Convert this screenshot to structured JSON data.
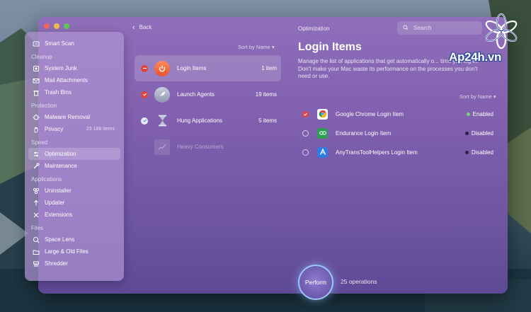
{
  "window": {
    "back_label": "Back",
    "panel_caption": "Optimization",
    "search_placeholder": "Search"
  },
  "sidebar": {
    "top_item": {
      "label": "Smart Scan",
      "icon": "smart-scan-icon"
    },
    "sections": [
      {
        "title": "Cleanup",
        "items": [
          {
            "label": "System Junk",
            "icon": "system-junk-icon"
          },
          {
            "label": "Mail Attachments",
            "icon": "mail-icon"
          },
          {
            "label": "Trash Bins",
            "icon": "trash-icon"
          }
        ]
      },
      {
        "title": "Protection",
        "items": [
          {
            "label": "Malware Removal",
            "icon": "malware-icon"
          },
          {
            "label": "Privacy",
            "icon": "privacy-hand-icon",
            "count": "23 188 items"
          }
        ]
      },
      {
        "title": "Speed",
        "items": [
          {
            "label": "Optimization",
            "icon": "optimization-icon",
            "active": true
          },
          {
            "label": "Maintenance",
            "icon": "maintenance-icon"
          }
        ]
      },
      {
        "title": "Applications",
        "items": [
          {
            "label": "Uninstaller",
            "icon": "uninstaller-icon"
          },
          {
            "label": "Updater",
            "icon": "updater-icon"
          },
          {
            "label": "Extensions",
            "icon": "extensions-icon"
          }
        ]
      },
      {
        "title": "Files",
        "items": [
          {
            "label": "Space Lens",
            "icon": "space-lens-icon"
          },
          {
            "label": "Large & Old Files",
            "icon": "folder-icon"
          },
          {
            "label": "Shredder",
            "icon": "shredder-icon"
          }
        ]
      }
    ]
  },
  "middle": {
    "sort_label": "Sort by Name ▾",
    "items": [
      {
        "label": "Login Items",
        "count": "1 item",
        "icon": "power-icon",
        "check": "partial",
        "active": true
      },
      {
        "label": "Launch Agents",
        "count": "19 items",
        "icon": "rocket-icon",
        "check": "checked"
      },
      {
        "label": "Hung Applications",
        "count": "5 items",
        "icon": "hourglass-icon",
        "check": "checked-blue"
      },
      {
        "label": "Heavy Consumers",
        "count": "",
        "icon": "graph-icon",
        "check": "none",
        "dim": true
      }
    ]
  },
  "panel": {
    "title": "Login Items",
    "description": "Manage the list of applications that get automatically o... time you log in. Don't make your Mac waste its performance on the processes you don't need or use.",
    "sort_label": "Sort by Name ▾",
    "items": [
      {
        "label": "Google Chrome Login Item",
        "status": "Enabled",
        "status_color": "#7bd46a",
        "checked": true,
        "icon": "chrome-icon"
      },
      {
        "label": "Endurance Login Item",
        "status": "Disabled",
        "status_color": "#2b2340",
        "checked": false,
        "icon": "endurance-icon"
      },
      {
        "label": "AnyTransToolHelpers Login Item",
        "status": "Disabled",
        "status_color": "#2b2340",
        "checked": false,
        "icon": "anytrans-icon"
      }
    ]
  },
  "footer": {
    "perform_label": "Perform",
    "operations": "25 operations"
  },
  "watermark": {
    "text": "Ap24h.vn"
  },
  "colors": {
    "accent_red": "#e0433f",
    "accent_blue": "#4a90e2",
    "enabled_green": "#7bd46a"
  }
}
